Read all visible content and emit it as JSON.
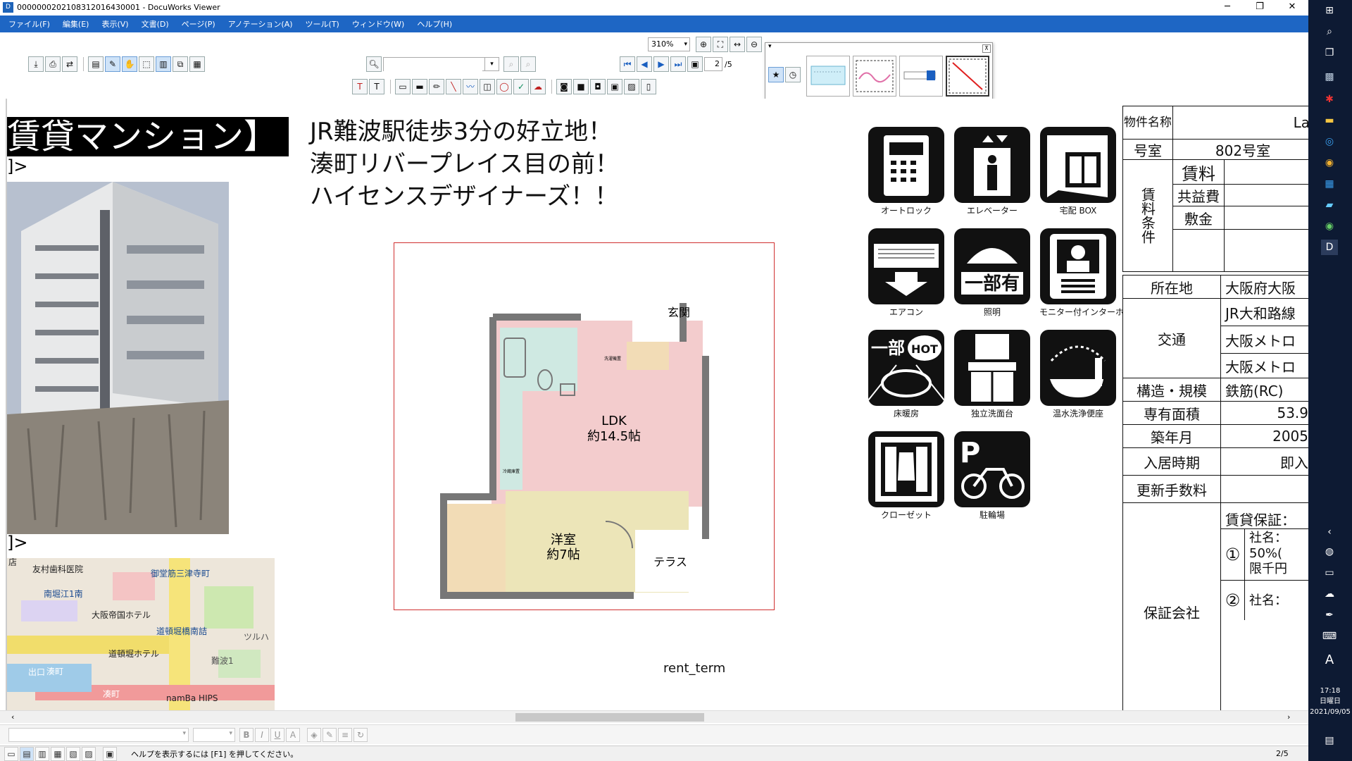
{
  "window": {
    "title": "0000000202108312016430001 - DocuWorks Viewer",
    "controls": [
      "─",
      "❐",
      "✕"
    ]
  },
  "menu": [
    "ファイル(F)",
    "編集(E)",
    "表示(V)",
    "文書(D)",
    "ページ(P)",
    "アノテーション(A)",
    "ツール(T)",
    "ウィンドウ(W)",
    "ヘルプ(H)"
  ],
  "toolbar": {
    "zoom": "310%",
    "search_value": "",
    "page_current": "2",
    "page_total": "/5"
  },
  "document": {
    "heading": "賃貸マンション】",
    "marker_top": "]>",
    "marker_bottom": "]>",
    "slogan": [
      "JR難波駅徒歩3分の好立地！",
      "湊町リバープレイス目の前！",
      "ハイセンスデザイナーズ！！"
    ],
    "floorplan": {
      "entrance": "玄関",
      "ldk": "LDK",
      "ldk_size": "約14.5帖",
      "western": "洋室",
      "western_size": "約7帖",
      "terrace": "テラス",
      "washer": "洗濯機置",
      "fridge": "冷蔵庫置"
    },
    "rent_term": "rent_term",
    "map_labels": [
      "友村歯科医院",
      "御堂筋三津寺町",
      "南堀江1南",
      "大阪帝国ホテル",
      "道頓堀橋南詰",
      "道頓堀ホテル",
      "湊町",
      "難波1",
      "namBa HIPS",
      "ツルハ",
      "出口",
      "凑町",
      "店"
    ],
    "amenities": [
      "オートロック",
      "エレベーター",
      "宅配 BOX",
      "エアコン",
      "照明",
      "モニター付インターホン",
      "床暖房",
      "独立洗面台",
      "温水洗浄便座",
      "クローゼット",
      "駐輪場"
    ],
    "amenity_badges": {
      "lighting": "一部有",
      "floorheat": "一部",
      "hot": "HOT",
      "parking": "P"
    },
    "specs": {
      "name_label": "物件名称",
      "name_value": "La",
      "room_label": "号室",
      "room_value": "802号室",
      "terms_label": "賃料条件",
      "rent_label": "賃料",
      "common_label": "共益費",
      "deposit_label": "敷金",
      "location_label": "所在地",
      "location_value": "大阪府大阪",
      "transport_label": "交通",
      "transport_values": [
        "JR大和路線",
        "大阪メトロ",
        "大阪メトロ"
      ],
      "structure_label": "構造・規模",
      "structure_value": "鉄筋(RC)",
      "area_label": "専有面積",
      "area_value": "53.9",
      "built_label": "築年月",
      "built_value": "2005",
      "movein_label": "入居時期",
      "movein_value": "即入",
      "renewal_label": "更新手数料",
      "guarantee_label": "保証会社",
      "guarantee_value": "賃貸保証：",
      "g1_num": "①",
      "g1_lines": [
        "社名：",
        "50%(",
        "限千円"
      ],
      "g2_num": "②",
      "g2_line": "社名："
    }
  },
  "statusbar": {
    "help": "ヘルプを表示するには [F1] を押してください。",
    "page": "2/5"
  },
  "taskbar": {
    "time": "17:18",
    "day": "日曜日",
    "date": "2021/09/05",
    "ime": "A"
  }
}
